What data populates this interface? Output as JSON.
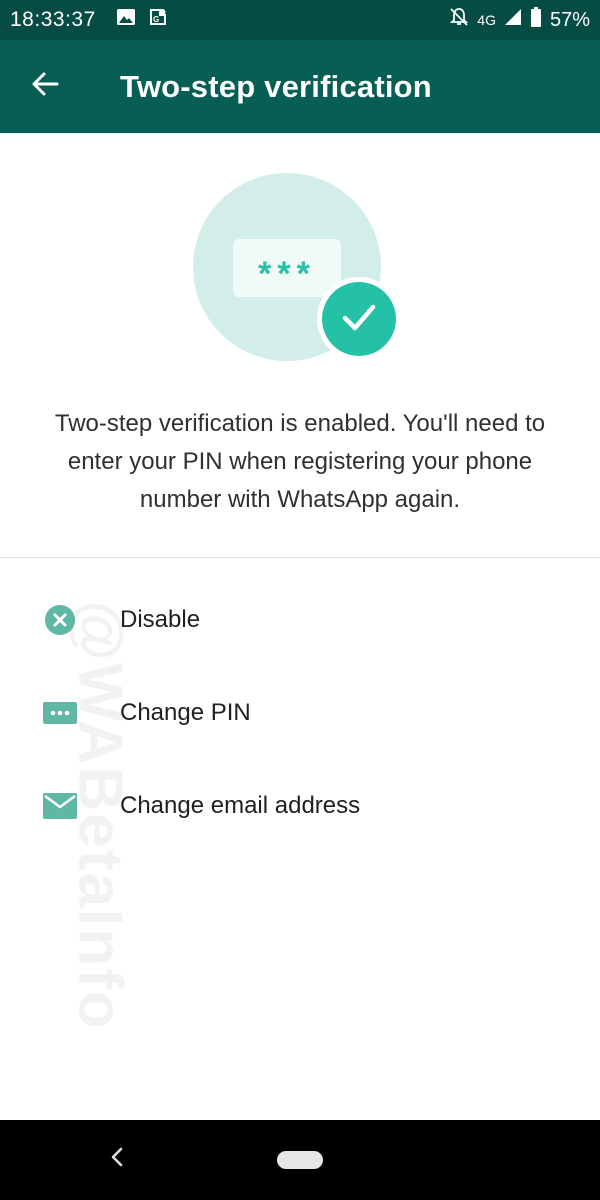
{
  "status_bar": {
    "time": "18:33:37",
    "network": "4G",
    "battery": "57%",
    "left_icons": [
      "image-icon",
      "maps-icon"
    ],
    "right_icons": [
      "notifications-off-icon",
      "signal-icon",
      "battery-icon"
    ]
  },
  "app_bar": {
    "title": "Two-step verification",
    "back_icon": "arrow-back-icon"
  },
  "hero": {
    "pin_mask": "***",
    "badge_icon": "check-icon"
  },
  "description": "Two-step verification is enabled. You'll need to enter your PIN when registering your phone number with WhatsApp again.",
  "menu": {
    "items": [
      {
        "label": "Disable",
        "icon": "disable-icon"
      },
      {
        "label": "Change PIN",
        "icon": "pin-icon"
      },
      {
        "label": "Change email address",
        "icon": "email-icon"
      }
    ]
  },
  "watermark": "@WABetaInfo",
  "colors": {
    "status_bar": "#054d44",
    "app_bar": "#075e54",
    "accent": "#25c1a6",
    "icon": "#5fb7a6",
    "hero_circle": "#d3ede8"
  }
}
